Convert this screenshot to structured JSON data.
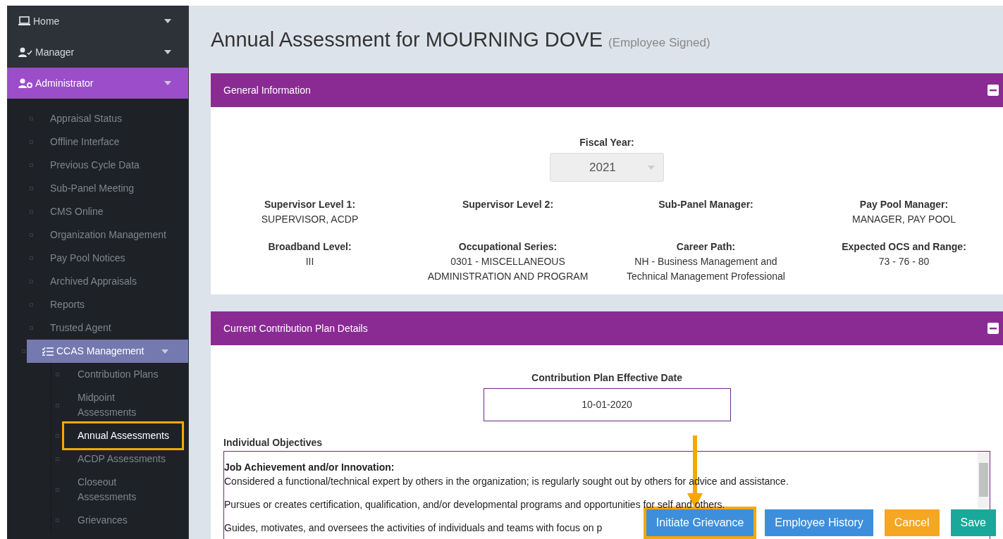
{
  "sidebar": {
    "items": [
      {
        "label": "Home",
        "selected": false
      },
      {
        "label": "Manager",
        "selected": false
      },
      {
        "label": "Administrator",
        "selected": true,
        "children": [
          {
            "label": "Appraisal Status",
            "selected": false
          },
          {
            "label": "Offline Interface",
            "selected": false
          },
          {
            "label": "Previous Cycle Data",
            "selected": false
          },
          {
            "label": "Sub-Panel Meeting",
            "selected": false
          },
          {
            "label": "CMS Online",
            "selected": false
          },
          {
            "label": "Organization Management",
            "selected": false
          },
          {
            "label": "Pay Pool Notices",
            "selected": false
          },
          {
            "label": "Archived Appraisals",
            "selected": false
          },
          {
            "label": "Reports",
            "selected": false
          },
          {
            "label": "Trusted Agent",
            "selected": false
          },
          {
            "label": "CCAS Management",
            "selected": true,
            "expanded": true,
            "children": [
              {
                "label": "Contribution Plans",
                "selected": false,
                "highlighted": false
              },
              {
                "label": "Midpoint Assessments",
                "selected": false,
                "highlighted": false
              },
              {
                "label": "Annual Assessments",
                "selected": true,
                "highlighted": true
              },
              {
                "label": "ACDP Assessments",
                "selected": false,
                "highlighted": false
              },
              {
                "label": "Closeout Assessments",
                "selected": false,
                "highlighted": false
              },
              {
                "label": "Grievances",
                "selected": false,
                "highlighted": false
              }
            ]
          }
        ]
      }
    ]
  },
  "page": {
    "title": "Annual Assessment for MOURNING DOVE",
    "status": "(Employee Signed)"
  },
  "general_information": {
    "title": "General Information",
    "expanded": true,
    "fiscal_year": {
      "label": "Fiscal Year:",
      "value": "2021"
    },
    "fields": [
      {
        "label": "Supervisor Level 1:",
        "value": [
          "SUPERVISOR, ACDP"
        ]
      },
      {
        "label": "Supervisor Level 2:"
      },
      {
        "label": "Sub-Panel Manager:"
      },
      {
        "label": "Pay Pool Manager:",
        "value": [
          "MANAGER, PAY POOL"
        ]
      },
      {
        "label": "Broadband Level:",
        "value": [
          "III"
        ]
      },
      {
        "label": "Occupational Series:",
        "value": [
          "0301 - MISCELLANEOUS",
          "ADMINISTRATION AND PROGRAM"
        ]
      },
      {
        "label": "Career Path:",
        "value": [
          "NH - Business Management and",
          "Technical Management Professional"
        ]
      },
      {
        "label": "Expected OCS and Range:",
        "value": [
          "73 - 76 - 80"
        ]
      }
    ]
  },
  "contribution_plan": {
    "title": "Current Contribution Plan Details",
    "expanded": true,
    "effective_date": {
      "label": "Contribution Plan Effective Date",
      "value": "10-01-2020"
    },
    "objectives": {
      "label": "Individual Objectives",
      "heading": "Job Achievement and/or Innovation:",
      "paragraphs": [
        "Considered a functional/technical expert by others in the organization; is regularly sought out by others for advice and assistance.",
        "Pursues or creates certification, qualification, and/or developmental programs and opportunities for self and others.",
        "Guides, motivates, and oversees the activities of individuals and teams with focus on p"
      ]
    }
  },
  "buttons": [
    {
      "label": "Initiate Grievance",
      "kind": "primary",
      "highlighted": true
    },
    {
      "label": "Employee History",
      "kind": "primary",
      "highlighted": false
    },
    {
      "label": "Cancel",
      "kind": "warning",
      "highlighted": false
    },
    {
      "label": "Save",
      "kind": "success",
      "highlighted": false
    }
  ]
}
